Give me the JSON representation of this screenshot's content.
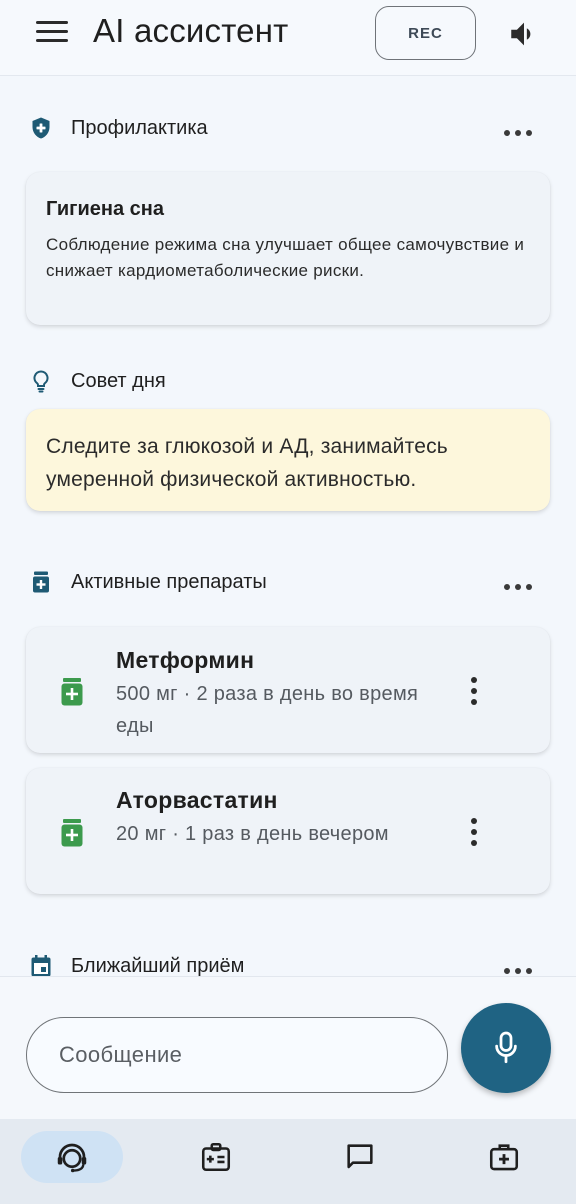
{
  "header": {
    "title": "AI ассистент",
    "rec_label": "REC",
    "icons": {
      "menu": "menu-icon",
      "volume": "volume-icon"
    }
  },
  "sections": {
    "prevention": {
      "title": "Профилактика",
      "icon": "shield-plus-icon",
      "card": {
        "title": "Гигиена сна",
        "text": "Соблюдение режима сна улучшает общее самочувствие и снижает кардиометаболические риски."
      }
    },
    "tip": {
      "title": "Совет дня",
      "icon": "lightbulb-icon",
      "text": "Следите за глюкозой и АД, занимайтесь умеренной физической активностью."
    },
    "medications": {
      "title": "Активные препараты",
      "icon": "medication-icon",
      "items": [
        {
          "name": "Метформин",
          "dose": "500 мг · 2 раза в день во время еды"
        },
        {
          "name": "Аторвастатин",
          "dose": "20 мг · 1 раз в день вечером"
        }
      ]
    },
    "appointment": {
      "title": "Ближайший приём",
      "icon": "calendar-icon"
    }
  },
  "composer": {
    "placeholder": "Сообщение",
    "value": "",
    "mic_icon": "microphone-icon"
  },
  "bottom_nav": {
    "items": [
      {
        "icon": "support-agent-icon",
        "active": true
      },
      {
        "icon": "medical-card-icon",
        "active": false
      },
      {
        "icon": "chat-icon",
        "active": false
      },
      {
        "icon": "medical-kit-icon",
        "active": false
      }
    ]
  },
  "colors": {
    "background": "#f3f7fc",
    "accent": "#1f6383",
    "section_icon": "#1e5a74",
    "med_icon": "#3c9a4d",
    "tip_card": "#fdf7dc",
    "card": "#eff3f8",
    "nav_active": "#cfe2f4"
  }
}
